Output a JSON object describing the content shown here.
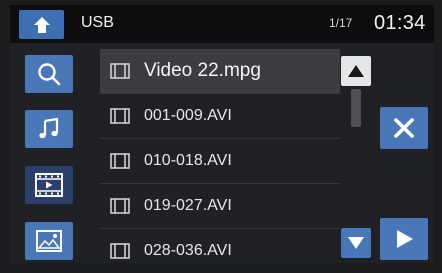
{
  "header": {
    "title": "USB",
    "page_indicator": "1/17",
    "clock": "01:34"
  },
  "sidebar": {
    "items": [
      {
        "name": "search",
        "icon": "search-icon"
      },
      {
        "name": "music",
        "icon": "music-note-icon"
      },
      {
        "name": "video",
        "icon": "video-film-icon",
        "active": true
      },
      {
        "name": "photo",
        "icon": "image-icon"
      }
    ]
  },
  "file_list": {
    "items": [
      {
        "label": "Video 22.mpg",
        "selected": true
      },
      {
        "label": "001-009.AVI"
      },
      {
        "label": "010-018.AVI"
      },
      {
        "label": "019-027.AVI"
      },
      {
        "label": "028-036.AVI"
      }
    ]
  },
  "colors": {
    "accent": "#4a77b8",
    "home": "#3f6fb3",
    "background": "#202124",
    "topbar": "#0d0d0e"
  }
}
